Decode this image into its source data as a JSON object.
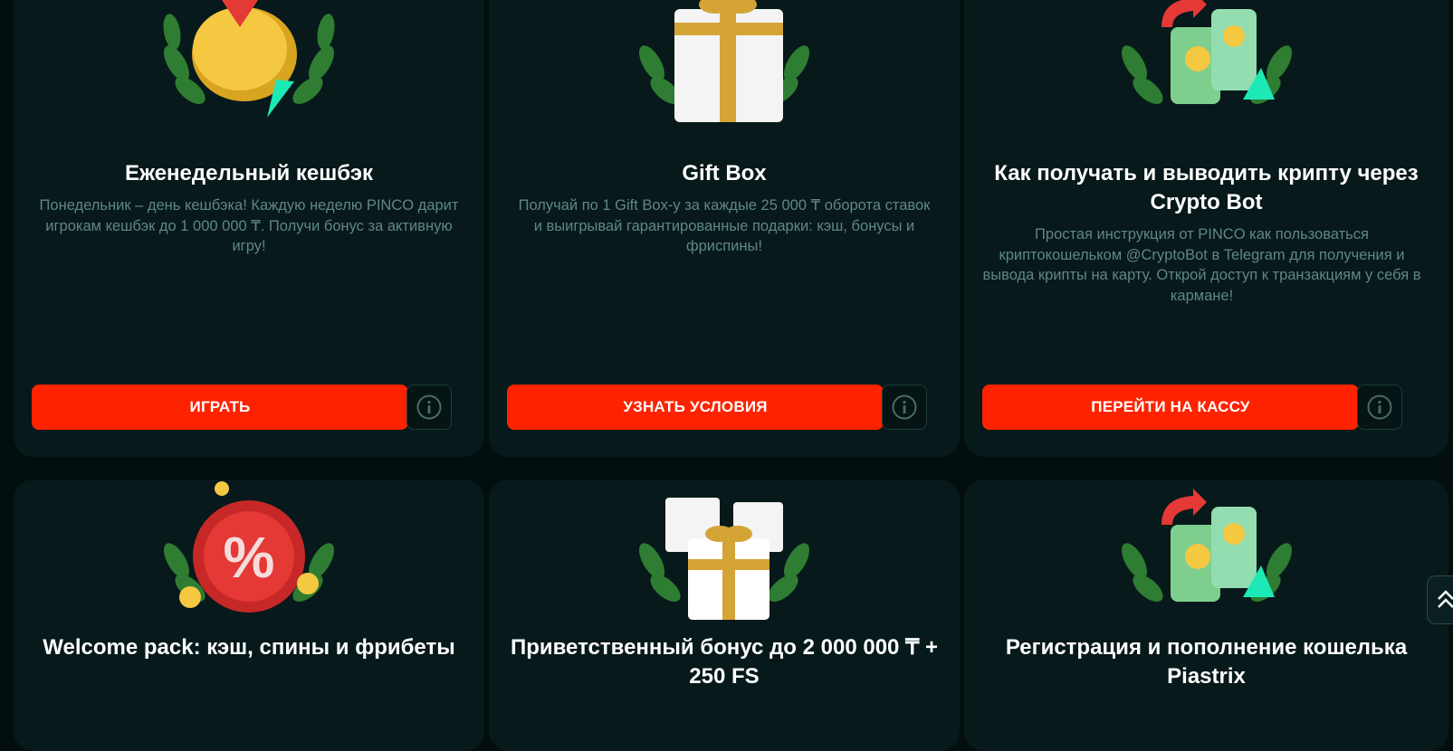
{
  "cards": [
    {
      "title": "Еженедельный кешбэк",
      "description": "Понедельник – день кешбэка! Каждую неделю PINCO дарит игрокам кешбэк до 1 000 000 ₸. Получи бонус за активную игру!",
      "button": "ИГРАТЬ",
      "icon": "cashback-coins-icon"
    },
    {
      "title": "Gift Box",
      "description": "Получай по 1 Gift Box-у за каждые 25 000 ₸ оборота ставок и выигрывай гарантированные подарки: кэш, бонусы и фриспины!",
      "button": "УЗНАТЬ УСЛОВИЯ",
      "icon": "gift-box-icon"
    },
    {
      "title": "Как получать и выводить крипту через Crypto Bot",
      "description": "Простая инструкция от PINCO как пользоваться криптокошельком @CryptoBot в Telegram для получения и вывода крипты на карту. Открой доступ к транзакциям у себя в кармане!",
      "button": "ПЕРЕЙТИ НА КАССУ",
      "icon": "money-exchange-icon"
    },
    {
      "title": "Welcome pack: кэш, спины и фрибеты",
      "icon": "percent-badge-icon"
    },
    {
      "title": "Приветственный бонус до 2 000 000 ₸ + 250 FS",
      "icon": "gift-boxes-icon"
    },
    {
      "title": "Регистрация и пополнение кошелька Piastrix",
      "icon": "money-exchange-icon"
    }
  ],
  "colors": {
    "page_bg": "#030f0e",
    "card_bg": "#07191a",
    "accent": "#ff2200",
    "muted_text": "#5f8783"
  }
}
